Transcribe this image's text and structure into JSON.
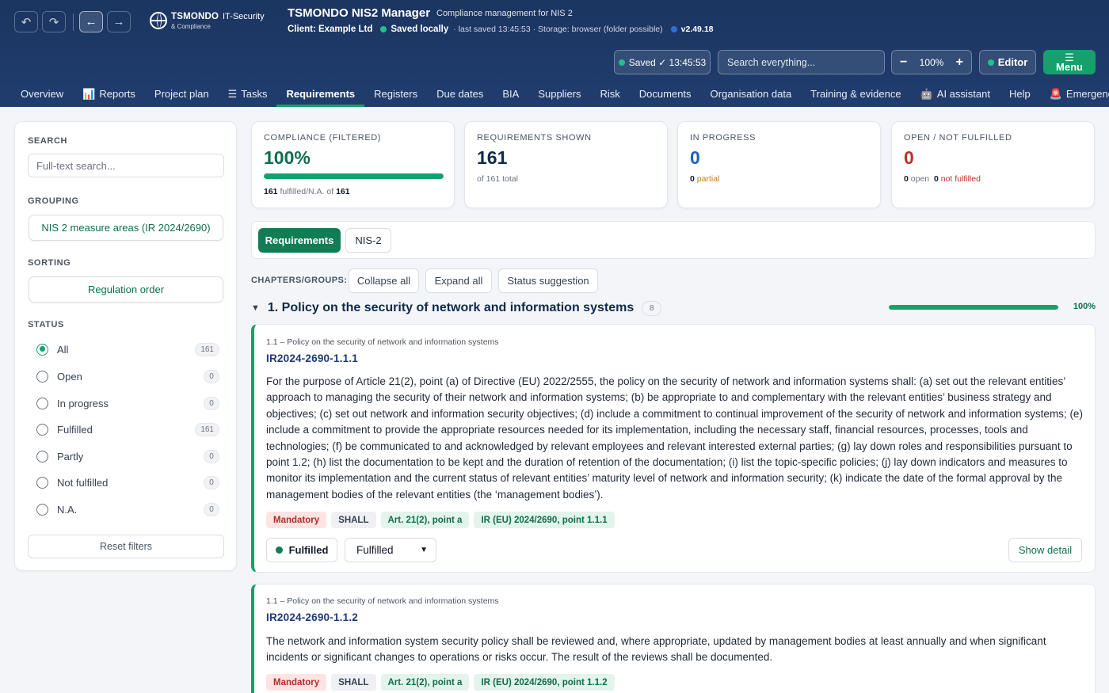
{
  "header": {
    "brand_name": "TSMONDO",
    "brand_sub": "& Compliance",
    "brand_tag": "IT-Security",
    "app_title": "TSMONDO NIS2 Manager",
    "app_subtitle": "Compliance management for NIS 2",
    "client": "Client: Example Ltd",
    "saved_state": "Saved locally",
    "last_saved": "· last saved 13:45:53 · Storage: browser (folder possible)",
    "version": "v2.49.18",
    "saved_pill": "Saved ✓ 13:45:53",
    "search_placeholder": "Search everything...",
    "zoom_minus": "−",
    "zoom_level": "100%",
    "zoom_plus": "+",
    "editor_label": "Editor",
    "menu_icon": "☰",
    "menu_label": "Menu"
  },
  "nav": {
    "overview": "Overview",
    "reports": "Reports",
    "project_plan": "Project plan",
    "tasks": "Tasks",
    "requirements": "Requirements",
    "registers": "Registers",
    "due_dates": "Due dates",
    "bia": "BIA",
    "suppliers": "Suppliers",
    "risk": "Risk",
    "documents": "Documents",
    "organisation_data": "Organisation data",
    "training": "Training & evidence",
    "ai_assistant": "AI assistant",
    "help": "Help",
    "emergency": "Emergency"
  },
  "sidebar": {
    "search_label": "SEARCH",
    "search_placeholder": "Full-text search...",
    "grouping_label": "GROUPING",
    "grouping_value": "NIS 2 measure areas (IR 2024/2690)",
    "sorting_label": "SORTING",
    "sorting_value": "Regulation order",
    "status_label": "STATUS",
    "statuses": [
      {
        "label": "All",
        "count": "161"
      },
      {
        "label": "Open",
        "count": "0"
      },
      {
        "label": "In progress",
        "count": "0"
      },
      {
        "label": "Fulfilled",
        "count": "161"
      },
      {
        "label": "Partly",
        "count": "0"
      },
      {
        "label": "Not fulfilled",
        "count": "0"
      },
      {
        "label": "N.A.",
        "count": "0"
      }
    ],
    "reset_label": "Reset filters"
  },
  "kpis": {
    "compliance": {
      "label": "COMPLIANCE (FILTERED)",
      "value": "100%",
      "progress": 1.0,
      "count": "161",
      "count_text": "fulfilled/N.A.",
      "of_text": "of",
      "total": "161"
    },
    "shown": {
      "label": "REQUIREMENTS SHOWN",
      "value": "161",
      "sub": "of 161 total"
    },
    "in_progress": {
      "label": "IN PROGRESS",
      "value": "0",
      "partial_count": "0",
      "partial_text": "partial"
    },
    "open": {
      "label": "OPEN / NOT FULFILLED",
      "value": "0",
      "open_count": "0",
      "open_text": "open",
      "nf_count": "0",
      "nf_text": "not fulfilled"
    }
  },
  "tabs": {
    "requirements": "Requirements",
    "nis2": "NIS-2"
  },
  "chapters": {
    "label": "CHAPTERS/GROUPS:",
    "collapse_all": "Collapse all",
    "expand_all": "Expand all",
    "status_suggestion": "Status suggestion"
  },
  "group": {
    "toggle": "▼",
    "title": "1. Policy on the security of network and information systems",
    "count": "8",
    "progress": 1.0,
    "percent": "100%"
  },
  "requirements": [
    {
      "crumb": "1.1 – Policy on the security of network and information systems",
      "id": "IR2024-2690-1.1.1",
      "text": "For the purpose of Article 21(2), point (a) of Directive (EU) 2022/2555, the policy on the security of network and information systems shall: (a) set out the relevant entities’ approach to managing the security of their network and information systems; (b) be appropriate to and complementary with the relevant entities’ business strategy and objectives; (c) set out network and information security objectives; (d) include a commitment to continual improvement of the security of network and information systems; (e) include a commitment to provide the appropriate resources needed for its implementation, including the necessary staff, financial resources, processes, tools and technologies; (f) be communicated to and acknowledged by relevant employees and relevant interested external parties; (g) lay down roles and responsibilities pursuant to point 1.2; (h) list the documentation to be kept and the duration of retention of the documentation; (i) list the topic-specific policies; (j) lay down indicators and measures to monitor its implementation and the current status of relevant entities’ maturity level of network and information security; (k) indicate the date of the formal approval by the management bodies of the relevant entities (the ‘management bodies’).",
      "tags": {
        "mandatory": "Mandatory",
        "shall": "SHALL",
        "article": "Art. 21(2), point a",
        "ir": "IR (EU) 2024/2690, point 1.1.1"
      },
      "status_pill": "Fulfilled",
      "status_select": "Fulfilled",
      "detail": "Show detail"
    },
    {
      "crumb": "1.1 – Policy on the security of network and information systems",
      "id": "IR2024-2690-1.1.2",
      "text": "The network and information system security policy shall be reviewed and, where appropriate, updated by management bodies at least annually and when significant incidents or significant changes to operations or risks occur. The result of the reviews shall be documented.",
      "tags": {
        "mandatory": "Mandatory",
        "shall": "SHALL",
        "article": "Art. 21(2), point a",
        "ir": "IR (EU) 2024/2690, point 1.1.2"
      }
    }
  ],
  "colors": {
    "header": "#1c3561",
    "accent": "#16a06b",
    "accent_dark": "#127d55",
    "danger": "#c0312f",
    "link": "#1e3a7a"
  }
}
